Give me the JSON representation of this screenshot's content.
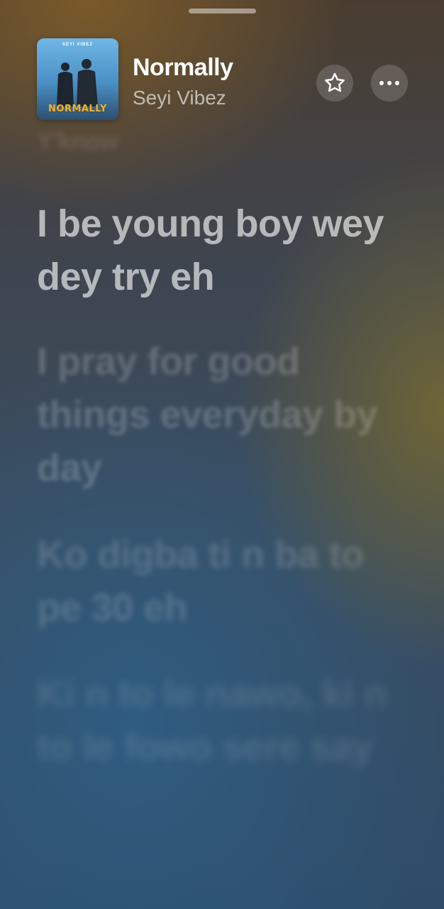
{
  "header": {
    "artwork": {
      "top_text": "SEYI VIBEZ",
      "title_text": "NORMALLY"
    },
    "title": "Normally",
    "artist": "Seyi Vibez",
    "favorite_icon": "star-icon",
    "more_icon": "ellipsis-icon"
  },
  "lyrics": {
    "previous_line": "Y'know",
    "current_line": "I be young boy wey dey try eh",
    "upcoming": [
      "I pray for good things everyday by day",
      "Ko digba ti n ba to pe 30 eh",
      "Ki n to le nawo, ki n to le fowo sere say"
    ]
  },
  "colors": {
    "background_top": "#4a3d30",
    "background_bottom": "#2e4c6a",
    "title_text": "#ffffff",
    "artwork_title": "#f2b42a"
  }
}
